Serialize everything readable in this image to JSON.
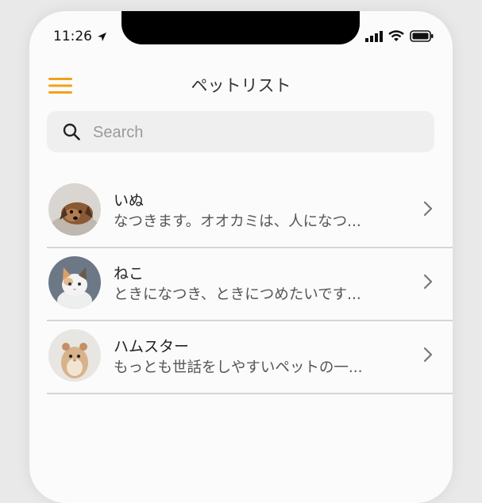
{
  "status": {
    "time": "11:26"
  },
  "header": {
    "title": "ペットリスト"
  },
  "search": {
    "placeholder": "Search"
  },
  "pets": [
    {
      "name": "いぬ",
      "description": "なつきます。オオカミは、人になつ..."
    },
    {
      "name": "ねこ",
      "description": "ときになつき、ときにつめたいです..."
    },
    {
      "name": "ハムスター",
      "description": "もっとも世話をしやすいペットの一..."
    }
  ],
  "icons": [
    "location-arrow-icon",
    "signal-icon",
    "wifi-icon",
    "battery-icon",
    "hamburger-menu-icon",
    "search-icon",
    "chevron-right-icon"
  ],
  "colors": {
    "accent": "#f0a21a",
    "background": "#fbfbfb",
    "search_bg": "#efefef",
    "divider": "#d6d6d6"
  }
}
